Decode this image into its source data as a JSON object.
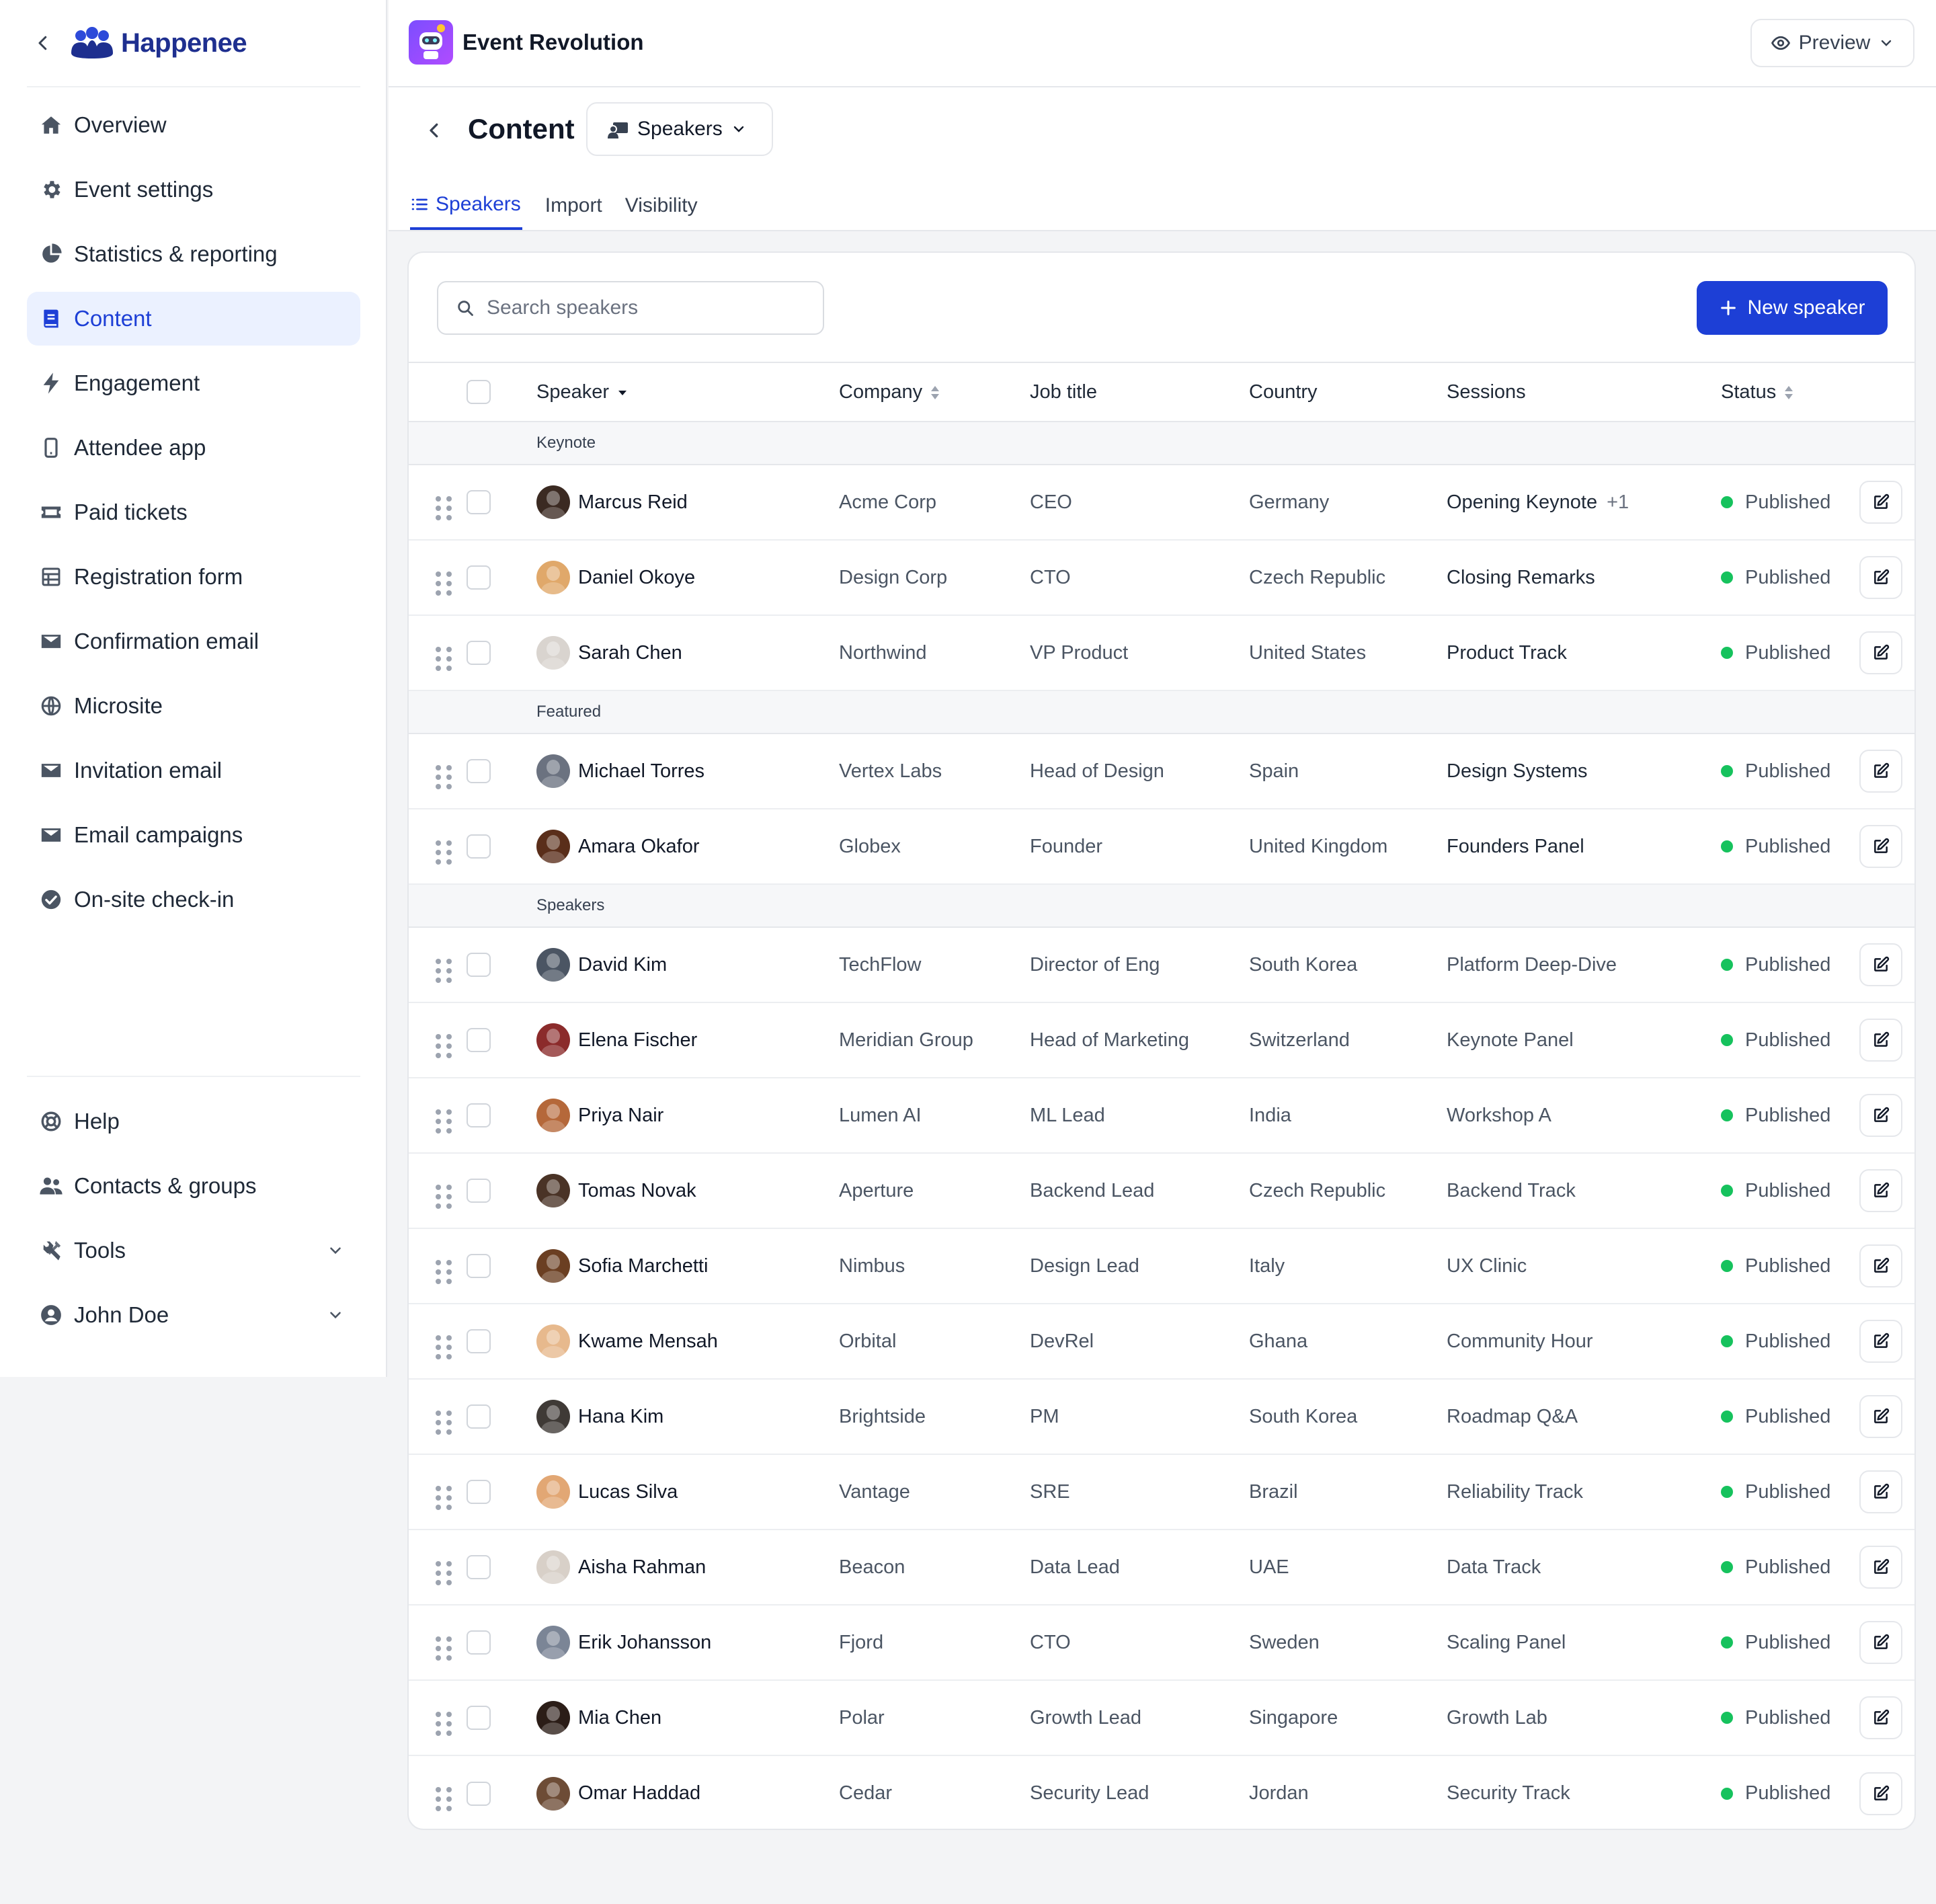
{
  "sidebar": {
    "brand": "Happenee",
    "nav": [
      {
        "label": "Overview",
        "icon": "home-icon"
      },
      {
        "label": "Event settings",
        "icon": "gear-icon"
      },
      {
        "label": "Statistics & reporting",
        "icon": "pie-chart-icon"
      },
      {
        "label": "Content",
        "icon": "book-icon",
        "active": true
      },
      {
        "label": "Engagement",
        "icon": "lightning-icon"
      },
      {
        "label": "Attendee app",
        "icon": "phone-icon"
      },
      {
        "label": "Paid tickets",
        "icon": "ticket-icon"
      },
      {
        "label": "Registration form",
        "icon": "table-icon"
      },
      {
        "label": "Confirmation email",
        "icon": "mail-icon"
      },
      {
        "label": "Microsite",
        "icon": "globe-icon"
      },
      {
        "label": "Invitation email",
        "icon": "mail-icon"
      },
      {
        "label": "Email campaigns",
        "icon": "mail-icon"
      },
      {
        "label": "On-site check-in",
        "icon": "check-circle-icon"
      }
    ],
    "bottom": [
      {
        "label": "Help",
        "icon": "lifebuoy-icon"
      },
      {
        "label": "Contacts & groups",
        "icon": "users-icon"
      },
      {
        "label": "Tools",
        "icon": "tools-icon",
        "expandable": true
      },
      {
        "label": "John Doe",
        "icon": "user-circle-icon",
        "expandable": true
      }
    ]
  },
  "topbar": {
    "event_title": "Event Revolution",
    "preview_label": "Preview"
  },
  "header": {
    "title": "Content",
    "type_select": "Speakers",
    "tabs": [
      {
        "label": "Speakers",
        "active": true
      },
      {
        "label": "Import"
      },
      {
        "label": "Visibility"
      }
    ]
  },
  "toolbar": {
    "search_placeholder": "Search speakers",
    "new_button": "New speaker"
  },
  "columns": {
    "speaker": "Speaker",
    "company": "Company",
    "job_title": "Job title",
    "country": "Country",
    "sessions": "Sessions",
    "status": "Status"
  },
  "groups": [
    {
      "label": "Keynote",
      "rows": [
        {
          "name": "Marcus Reid",
          "company": "Acme Corp",
          "job": "CEO",
          "country": "Germany",
          "session": "Opening Keynote",
          "more": "+1",
          "status": "Published",
          "avatar": "#3b2a22"
        },
        {
          "name": "Daniel Okoye",
          "company": "Design Corp",
          "job": "CTO",
          "country": "Czech Republic",
          "session": "Closing Remarks",
          "status": "Published",
          "avatar": "#e0a86a"
        },
        {
          "name": "Sarah Chen",
          "company": "Northwind",
          "job": "VP Product",
          "country": "United States",
          "session": "Product Track",
          "status": "Published",
          "avatar": "#d9d4cf"
        }
      ]
    },
    {
      "label": "Featured",
      "rows": [
        {
          "name": "Michael Torres",
          "company": "Vertex Labs",
          "job": "Head of Design",
          "country": "Spain",
          "session": "Design Systems",
          "status": "Published",
          "avatar": "#6b7280"
        },
        {
          "name": "Amara Okafor",
          "company": "Globex",
          "job": "Founder",
          "country": "United Kingdom",
          "session": "Founders Panel",
          "status": "Published",
          "avatar": "#5a2e1a"
        }
      ]
    },
    {
      "label": "Speakers",
      "rows": [
        {
          "name": "David Kim",
          "company": "TechFlow",
          "job": "Director of Eng",
          "country": "South Korea",
          "session": "Platform Deep-Dive",
          "status": "Published",
          "avatar": "#4b5563"
        },
        {
          "name": "Elena Fischer",
          "company": "Meridian Group",
          "job": "Head of Marketing",
          "country": "Switzerland",
          "session": "Keynote Panel",
          "status": "Published",
          "avatar": "#8b2b2b"
        },
        {
          "name": "Priya Nair",
          "company": "Lumen AI",
          "job": "ML Lead",
          "country": "India",
          "session": "Workshop A",
          "status": "Published",
          "avatar": "#b5683a"
        },
        {
          "name": "Tomas Novak",
          "company": "Aperture",
          "job": "Backend Lead",
          "country": "Czech Republic",
          "session": "Backend Track",
          "status": "Published",
          "avatar": "#4a3326"
        },
        {
          "name": "Sofia Marchetti",
          "company": "Nimbus",
          "job": "Design Lead",
          "country": "Italy",
          "session": "UX Clinic",
          "status": "Published",
          "avatar": "#6b3f22"
        },
        {
          "name": "Kwame Mensah",
          "company": "Orbital",
          "job": "DevRel",
          "country": "Ghana",
          "session": "Community Hour",
          "status": "Published",
          "avatar": "#e7b98d"
        },
        {
          "name": "Hana Kim",
          "company": "Brightside",
          "job": "PM",
          "country": "South Korea",
          "session": "Roadmap Q&A",
          "status": "Published",
          "avatar": "#3f3a36"
        },
        {
          "name": "Lucas Silva",
          "company": "Vantage",
          "job": "SRE",
          "country": "Brazil",
          "session": "Reliability Track",
          "status": "Published",
          "avatar": "#e2a774"
        },
        {
          "name": "Aisha Rahman",
          "company": "Beacon",
          "job": "Data Lead",
          "country": "UAE",
          "session": "Data Track",
          "status": "Published",
          "avatar": "#d8d0c8"
        },
        {
          "name": "Erik Johansson",
          "company": "Fjord",
          "job": "CTO",
          "country": "Sweden",
          "session": "Scaling Panel",
          "status": "Published",
          "avatar": "#7b8596"
        },
        {
          "name": "Mia Chen",
          "company": "Polar",
          "job": "Growth Lead",
          "country": "Singapore",
          "session": "Growth Lab",
          "status": "Published",
          "avatar": "#2b1d17"
        },
        {
          "name": "Omar Haddad",
          "company": "Cedar",
          "job": "Security Lead",
          "country": "Jordan",
          "session": "Security Track",
          "status": "Published",
          "avatar": "#6d4c36"
        }
      ]
    }
  ]
}
